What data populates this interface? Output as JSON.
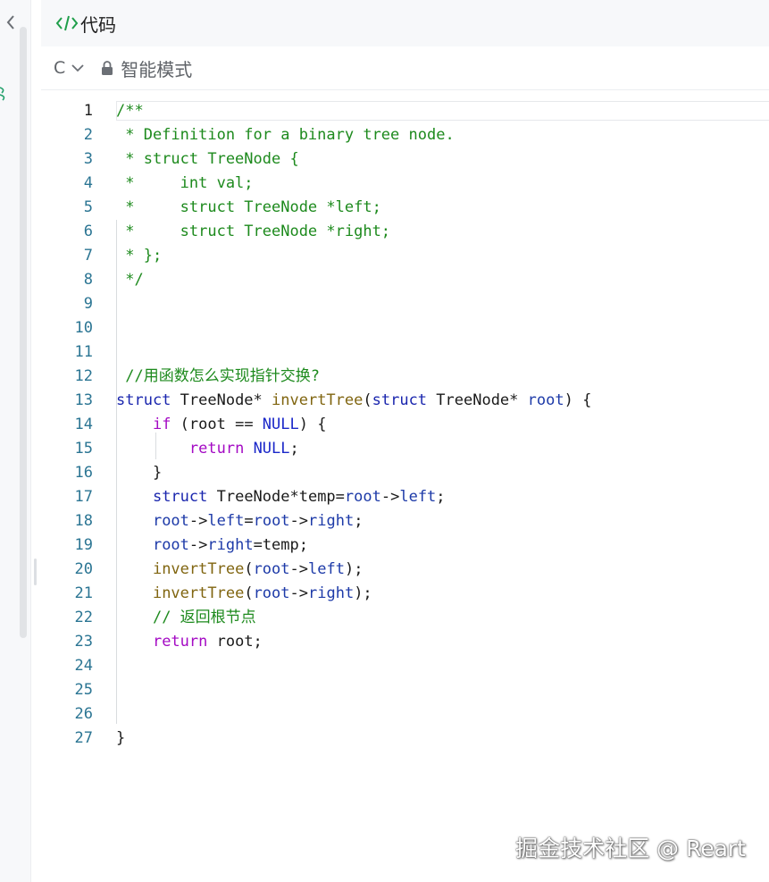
{
  "header": {
    "title": "代码",
    "icon": "code-icon"
  },
  "toolbar": {
    "language": "C",
    "mode": "智能模式"
  },
  "editor": {
    "active_line": 1,
    "lines": [
      {
        "n": "1",
        "tokens": [
          {
            "t": "/**",
            "c": "cm"
          }
        ]
      },
      {
        "n": "2",
        "tokens": [
          {
            "t": " * Definition for a binary tree node.",
            "c": "cm"
          }
        ]
      },
      {
        "n": "3",
        "tokens": [
          {
            "t": " * struct TreeNode {",
            "c": "cm"
          }
        ]
      },
      {
        "n": "4",
        "tokens": [
          {
            "t": " *     int val;",
            "c": "cm"
          }
        ]
      },
      {
        "n": "5",
        "tokens": [
          {
            "t": " *     struct TreeNode *left;",
            "c": "cm"
          }
        ]
      },
      {
        "n": "6",
        "tokens": [
          {
            "t": " *     struct TreeNode *right;",
            "c": "cm"
          }
        ]
      },
      {
        "n": "7",
        "tokens": [
          {
            "t": " * };",
            "c": "cm"
          }
        ]
      },
      {
        "n": "8",
        "tokens": [
          {
            "t": " */",
            "c": "cm"
          }
        ]
      },
      {
        "n": "9",
        "tokens": []
      },
      {
        "n": "10",
        "tokens": []
      },
      {
        "n": "11",
        "tokens": []
      },
      {
        "n": "12",
        "tokens": [
          {
            "t": " //用函数怎么实现指针交换?",
            "c": "cm"
          }
        ]
      },
      {
        "n": "13",
        "tokens": [
          {
            "t": "struct",
            "c": "kw"
          },
          {
            "t": " TreeNode* ",
            "c": "pl"
          },
          {
            "t": "invertTree",
            "c": "fn"
          },
          {
            "t": "(",
            "c": "pl"
          },
          {
            "t": "struct",
            "c": "kw"
          },
          {
            "t": " TreeNode* ",
            "c": "pl"
          },
          {
            "t": "root",
            "c": "var"
          },
          {
            "t": ") {",
            "c": "pl"
          }
        ]
      },
      {
        "n": "14",
        "tokens": [
          {
            "t": "    ",
            "c": "pl"
          },
          {
            "t": "if",
            "c": "ctl"
          },
          {
            "t": " (root == ",
            "c": "pl"
          },
          {
            "t": "NULL",
            "c": "con"
          },
          {
            "t": ") {",
            "c": "pl"
          }
        ]
      },
      {
        "n": "15",
        "tokens": [
          {
            "t": "        ",
            "c": "pl"
          },
          {
            "t": "return",
            "c": "ctl"
          },
          {
            "t": " ",
            "c": "pl"
          },
          {
            "t": "NULL",
            "c": "con"
          },
          {
            "t": ";",
            "c": "pl"
          }
        ]
      },
      {
        "n": "16",
        "tokens": [
          {
            "t": "    }",
            "c": "pl"
          }
        ]
      },
      {
        "n": "17",
        "tokens": [
          {
            "t": "    ",
            "c": "pl"
          },
          {
            "t": "struct",
            "c": "kw"
          },
          {
            "t": " TreeNode*temp=",
            "c": "pl"
          },
          {
            "t": "root",
            "c": "var"
          },
          {
            "t": "->",
            "c": "pl"
          },
          {
            "t": "left",
            "c": "var"
          },
          {
            "t": ";",
            "c": "pl"
          }
        ]
      },
      {
        "n": "18",
        "tokens": [
          {
            "t": "    ",
            "c": "pl"
          },
          {
            "t": "root",
            "c": "var"
          },
          {
            "t": "->",
            "c": "pl"
          },
          {
            "t": "left",
            "c": "var"
          },
          {
            "t": "=",
            "c": "pl"
          },
          {
            "t": "root",
            "c": "var"
          },
          {
            "t": "->",
            "c": "pl"
          },
          {
            "t": "right",
            "c": "var"
          },
          {
            "t": ";",
            "c": "pl"
          }
        ]
      },
      {
        "n": "19",
        "tokens": [
          {
            "t": "    ",
            "c": "pl"
          },
          {
            "t": "root",
            "c": "var"
          },
          {
            "t": "->",
            "c": "pl"
          },
          {
            "t": "right",
            "c": "var"
          },
          {
            "t": "=temp;",
            "c": "pl"
          }
        ]
      },
      {
        "n": "20",
        "tokens": [
          {
            "t": "    ",
            "c": "pl"
          },
          {
            "t": "invertTree",
            "c": "fn"
          },
          {
            "t": "(",
            "c": "pl"
          },
          {
            "t": "root",
            "c": "var"
          },
          {
            "t": "->",
            "c": "pl"
          },
          {
            "t": "left",
            "c": "var"
          },
          {
            "t": ");",
            "c": "pl"
          }
        ]
      },
      {
        "n": "21",
        "tokens": [
          {
            "t": "    ",
            "c": "pl"
          },
          {
            "t": "invertTree",
            "c": "fn"
          },
          {
            "t": "(",
            "c": "pl"
          },
          {
            "t": "root",
            "c": "var"
          },
          {
            "t": "->",
            "c": "pl"
          },
          {
            "t": "right",
            "c": "var"
          },
          {
            "t": ");",
            "c": "pl"
          }
        ]
      },
      {
        "n": "22",
        "tokens": [
          {
            "t": "    ",
            "c": "pl"
          },
          {
            "t": "// 返回根节点",
            "c": "cm"
          }
        ]
      },
      {
        "n": "23",
        "tokens": [
          {
            "t": "    ",
            "c": "pl"
          },
          {
            "t": "return",
            "c": "ctl"
          },
          {
            "t": " root;",
            "c": "pl"
          }
        ]
      },
      {
        "n": "24",
        "tokens": []
      },
      {
        "n": "25",
        "tokens": []
      },
      {
        "n": "26",
        "tokens": []
      },
      {
        "n": "27",
        "tokens": [
          {
            "t": "}",
            "c": "pl"
          }
        ]
      }
    ]
  },
  "watermark": "掘金技术社区 @ Reart"
}
